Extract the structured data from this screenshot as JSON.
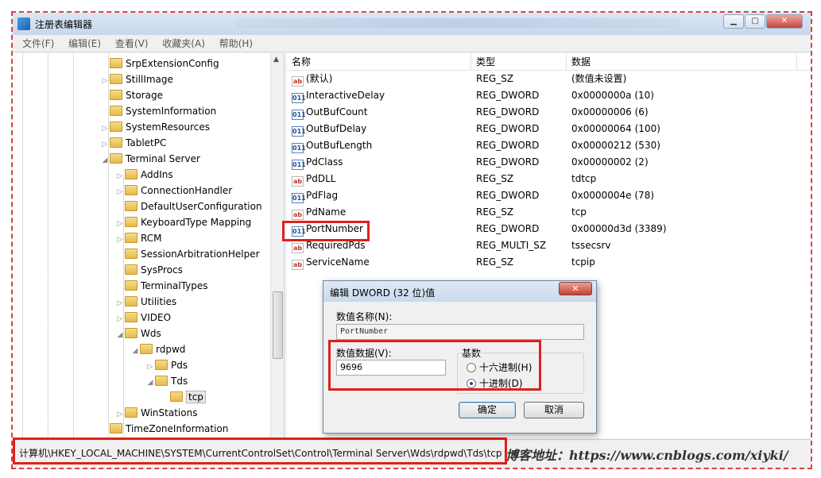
{
  "window": {
    "title": "注册表编辑器"
  },
  "menubar": [
    "文件(F)",
    "编辑(E)",
    "查看(V)",
    "收藏夹(A)",
    "帮助(H)"
  ],
  "tree": {
    "items": [
      {
        "label": "SrpExtensionConfig",
        "arrow": ""
      },
      {
        "label": "StillImage",
        "arrow": "▷"
      },
      {
        "label": "Storage",
        "arrow": ""
      },
      {
        "label": "SystemInformation",
        "arrow": ""
      },
      {
        "label": "SystemResources",
        "arrow": "▷"
      },
      {
        "label": "TabletPC",
        "arrow": "▷"
      },
      {
        "label": "Terminal Server",
        "arrow": "◢"
      },
      {
        "label": "AddIns",
        "arrow": "▷"
      },
      {
        "label": "ConnectionHandler",
        "arrow": "▷"
      },
      {
        "label": "DefaultUserConfiguration",
        "arrow": ""
      },
      {
        "label": "KeyboardType Mapping",
        "arrow": "▷"
      },
      {
        "label": "RCM",
        "arrow": "▷"
      },
      {
        "label": "SessionArbitrationHelper",
        "arrow": ""
      },
      {
        "label": "SysProcs",
        "arrow": ""
      },
      {
        "label": "TerminalTypes",
        "arrow": ""
      },
      {
        "label": "Utilities",
        "arrow": "▷"
      },
      {
        "label": "VIDEO",
        "arrow": "▷"
      },
      {
        "label": "Wds",
        "arrow": "◢"
      },
      {
        "label": "rdpwd",
        "arrow": "◢"
      },
      {
        "label": "Pds",
        "arrow": "▷"
      },
      {
        "label": "Tds",
        "arrow": "◢"
      },
      {
        "label": "tcp",
        "arrow": ""
      },
      {
        "label": "WinStations",
        "arrow": "▷"
      },
      {
        "label": "TimeZoneInformation",
        "arrow": ""
      }
    ]
  },
  "values": {
    "headers": {
      "name": "名称",
      "type": "类型",
      "data": "数据"
    },
    "rows": [
      {
        "icon": "ab",
        "name": "(默认)",
        "type": "REG_SZ",
        "data": "(数值未设置)"
      },
      {
        "icon": "011",
        "name": "InteractiveDelay",
        "type": "REG_DWORD",
        "data": "0x0000000a (10)"
      },
      {
        "icon": "011",
        "name": "OutBufCount",
        "type": "REG_DWORD",
        "data": "0x00000006 (6)"
      },
      {
        "icon": "011",
        "name": "OutBufDelay",
        "type": "REG_DWORD",
        "data": "0x00000064 (100)"
      },
      {
        "icon": "011",
        "name": "OutBufLength",
        "type": "REG_DWORD",
        "data": "0x00000212 (530)"
      },
      {
        "icon": "011",
        "name": "PdClass",
        "type": "REG_DWORD",
        "data": "0x00000002 (2)"
      },
      {
        "icon": "ab",
        "name": "PdDLL",
        "type": "REG_SZ",
        "data": "tdtcp"
      },
      {
        "icon": "011",
        "name": "PdFlag",
        "type": "REG_DWORD",
        "data": "0x0000004e (78)"
      },
      {
        "icon": "ab",
        "name": "PdName",
        "type": "REG_SZ",
        "data": "tcp"
      },
      {
        "icon": "011",
        "name": "PortNumber",
        "type": "REG_DWORD",
        "data": "0x00000d3d (3389)"
      },
      {
        "icon": "ab",
        "name": "RequiredPds",
        "type": "REG_MULTI_SZ",
        "data": "tssecsrv"
      },
      {
        "icon": "ab",
        "name": "ServiceName",
        "type": "REG_SZ",
        "data": "tcpip"
      }
    ]
  },
  "dialog": {
    "title": "编辑 DWORD (32 位)值",
    "close": "✕",
    "name_label": "数值名称(N):",
    "name_value": "PortNumber",
    "data_label": "数值数据(V):",
    "data_value": "9696",
    "base_label": "基数",
    "hex_label": "十六进制(H)",
    "dec_label": "十进制(D)",
    "selected_base": "dec",
    "ok": "确定",
    "cancel": "取消"
  },
  "statusbar": {
    "path": "计算机\\HKEY_LOCAL_MACHINE\\SYSTEM\\CurrentControlSet\\Control\\Terminal Server\\Wds\\rdpwd\\Tds\\tcp",
    "watermark": "博客地址：https://www.cnblogs.com/xiyki/"
  },
  "colors": {
    "highlight": "#e0201a",
    "frame_dash": "#e23b3b",
    "titlebar": "#c7d7ec"
  }
}
